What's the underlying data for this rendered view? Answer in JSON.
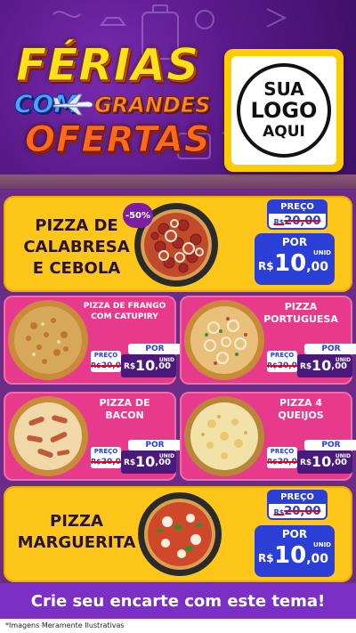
{
  "header": {
    "title_line1": "FÉRIAS",
    "title_com": "COM",
    "title_grandes": "GRANDES",
    "title_line3": "OFERTAS",
    "logo_line1": "SUA",
    "logo_line2": "LOGO",
    "logo_line3": "AQUI"
  },
  "products": {
    "calabresa": {
      "name": "PIZZA DE\nCALABRESA\nE CEBOLA",
      "discount": "-50%",
      "preco_label": "PREÇO",
      "old_currency": "R$",
      "old_price": "20,00",
      "por_label": "POR",
      "currency": "R$",
      "price_int": "10",
      "price_cents": ",00",
      "unit": "UNID"
    },
    "frango": {
      "name": "PIZZA DE FRANGO\nCOM CATUPIRY",
      "por_label": "POR",
      "preco_label": "PREÇO",
      "old_currency": "R$",
      "old_price": "20,00",
      "currency": "R$",
      "price_int": "10",
      "price_cents": ",00",
      "unit": "UNID"
    },
    "portuguesa": {
      "name": "PIZZA\nPORTUGUESA",
      "por_label": "POR",
      "preco_label": "PREÇO",
      "old_currency": "R$",
      "old_price": "20,00",
      "currency": "R$",
      "price_int": "10",
      "price_cents": ",00",
      "unit": "UNID"
    },
    "bacon": {
      "name": "PIZZA DE\nBACON",
      "por_label": "POR",
      "preco_label": "PREÇO",
      "old_currency": "R$",
      "old_price": "20,00",
      "currency": "R$",
      "price_int": "10",
      "price_cents": ",00",
      "unit": "UNID"
    },
    "queijos": {
      "name": "PIZZA 4\nQUEIJOS",
      "por_label": "POR",
      "preco_label": "PREÇO",
      "old_currency": "R$",
      "old_price": "20,00",
      "currency": "R$",
      "price_int": "10",
      "price_cents": ",00",
      "unit": "UNID"
    },
    "marguerita": {
      "name": "PIZZA\nMARGUERITA",
      "preco_label": "PREÇO",
      "old_currency": "R$",
      "old_price": "20,00",
      "por_label": "POR",
      "currency": "R$",
      "price_int": "10",
      "price_cents": ",00",
      "unit": "UNID"
    }
  },
  "footer": {
    "cta": "Crie seu encarte com este tema!",
    "disclaimer": "*Imagens Meramente Ilustrativas"
  },
  "colors": {
    "purple_bg": "#6a2c86",
    "yellow_card": "#ffc61a",
    "pink_card": "#e83a8c",
    "blue_price": "#2b3fd6"
  }
}
